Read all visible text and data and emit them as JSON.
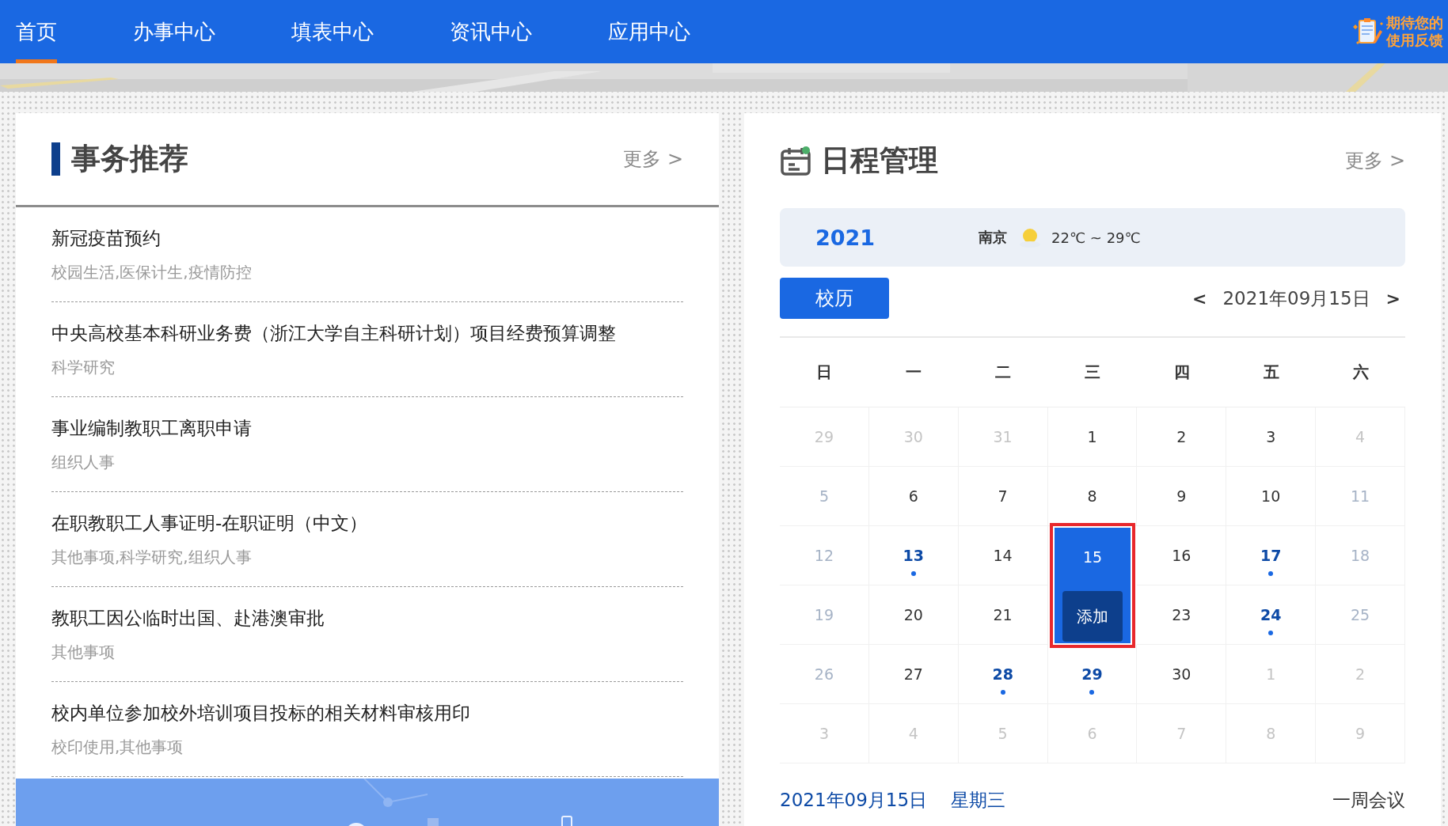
{
  "nav": {
    "items": [
      {
        "label": "首页",
        "selected": true
      },
      {
        "label": "办事中心",
        "selected": false
      },
      {
        "label": "填表中心",
        "selected": false
      },
      {
        "label": "资讯中心",
        "selected": false
      },
      {
        "label": "应用中心",
        "selected": false
      }
    ],
    "feedback": [
      "期待您的",
      "使用反馈"
    ]
  },
  "affairs": {
    "title": "事务推荐",
    "more": "更多 >",
    "items": [
      {
        "title": "新冠疫苗预约",
        "tags": "校园生活,医保计生,疫情防控"
      },
      {
        "title": "中央高校基本科研业务费（浙江大学自主科研计划）项目经费预算调整",
        "tags": "科学研究"
      },
      {
        "title": "事业编制教职工离职申请",
        "tags": "组织人事"
      },
      {
        "title": "在职教职工人事证明-在职证明（中文）",
        "tags": "其他事项,科学研究,组织人事"
      },
      {
        "title": "教职工因公临时出国、赴港澳审批",
        "tags": "其他事项"
      },
      {
        "title": "校内单位参加校外培训项目投标的相关材料审核用印",
        "tags": "校印使用,其他事项"
      }
    ]
  },
  "schedule": {
    "title": "日程管理",
    "more": "更多 >",
    "year": "2021",
    "city": "南京",
    "temperature": "22℃ ~ 29℃",
    "calendar_button": "校历",
    "prev": "<",
    "date": "2021年09月15日",
    "next": ">",
    "weekdays": [
      "日",
      "一",
      "二",
      "三",
      "四",
      "五",
      "六"
    ],
    "add_button": "添加",
    "days": [
      {
        "day": "29",
        "kind": "outside",
        "event": false,
        "selected": false
      },
      {
        "day": "30",
        "kind": "outside",
        "event": false,
        "selected": false
      },
      {
        "day": "31",
        "kind": "outside",
        "event": false,
        "selected": false
      },
      {
        "day": "1",
        "kind": "weekday",
        "event": false,
        "selected": false
      },
      {
        "day": "2",
        "kind": "weekday",
        "event": false,
        "selected": false
      },
      {
        "day": "3",
        "kind": "weekday",
        "event": false,
        "selected": false
      },
      {
        "day": "4",
        "kind": "outside",
        "event": false,
        "selected": false
      },
      {
        "day": "5",
        "kind": "weekend",
        "event": false,
        "selected": false
      },
      {
        "day": "6",
        "kind": "weekday",
        "event": false,
        "selected": false
      },
      {
        "day": "7",
        "kind": "weekday",
        "event": false,
        "selected": false
      },
      {
        "day": "8",
        "kind": "weekday",
        "event": false,
        "selected": false
      },
      {
        "day": "9",
        "kind": "weekday",
        "event": false,
        "selected": false
      },
      {
        "day": "10",
        "kind": "weekday",
        "event": false,
        "selected": false
      },
      {
        "day": "11",
        "kind": "weekend",
        "event": false,
        "selected": false
      },
      {
        "day": "12",
        "kind": "weekend",
        "event": false,
        "selected": false
      },
      {
        "day": "13",
        "kind": "weekday",
        "event": true,
        "selected": false
      },
      {
        "day": "14",
        "kind": "weekday",
        "event": false,
        "selected": false
      },
      {
        "day": "15",
        "kind": "weekday",
        "event": false,
        "selected": true
      },
      {
        "day": "16",
        "kind": "weekday",
        "event": false,
        "selected": false
      },
      {
        "day": "17",
        "kind": "weekday",
        "event": true,
        "selected": false
      },
      {
        "day": "18",
        "kind": "weekend",
        "event": false,
        "selected": false
      },
      {
        "day": "19",
        "kind": "weekend",
        "event": false,
        "selected": false
      },
      {
        "day": "20",
        "kind": "weekday",
        "event": false,
        "selected": false
      },
      {
        "day": "21",
        "kind": "weekday",
        "event": false,
        "selected": false
      },
      {
        "day": "23",
        "kind": "weekday",
        "event": false,
        "selected": false
      },
      {
        "day": "24",
        "kind": "weekday",
        "event": true,
        "selected": false
      },
      {
        "day": "25",
        "kind": "weekend",
        "event": false,
        "selected": false
      },
      {
        "day": "26",
        "kind": "weekend",
        "event": false,
        "selected": false
      },
      {
        "day": "27",
        "kind": "weekday",
        "event": false,
        "selected": false
      },
      {
        "day": "28",
        "kind": "weekday",
        "event": true,
        "selected": false
      },
      {
        "day": "29",
        "kind": "weekday",
        "event": true,
        "selected": false
      },
      {
        "day": "30",
        "kind": "weekday",
        "event": false,
        "selected": false
      },
      {
        "day": "1",
        "kind": "outside",
        "event": false,
        "selected": false
      },
      {
        "day": "2",
        "kind": "outside",
        "event": false,
        "selected": false
      },
      {
        "day": "3",
        "kind": "outside",
        "event": false,
        "selected": false
      },
      {
        "day": "4",
        "kind": "outside",
        "event": false,
        "selected": false
      },
      {
        "day": "5",
        "kind": "outside",
        "event": false,
        "selected": false
      },
      {
        "day": "6",
        "kind": "outside",
        "event": false,
        "selected": false
      },
      {
        "day": "7",
        "kind": "outside",
        "event": false,
        "selected": false
      },
      {
        "day": "8",
        "kind": "outside",
        "event": false,
        "selected": false
      },
      {
        "day": "9",
        "kind": "outside",
        "event": false,
        "selected": false
      }
    ],
    "footer_date": "2021年09月15日",
    "footer_weekday": "星期三",
    "footer_event": "一周会议"
  }
}
